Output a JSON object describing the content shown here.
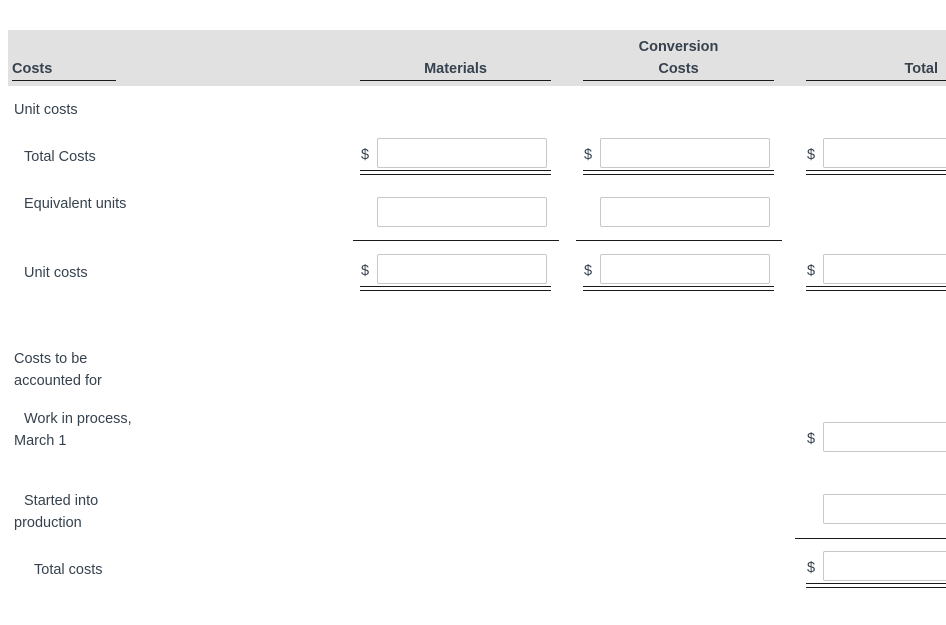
{
  "header": {
    "costs_label": "Costs",
    "materials_label": "Materials",
    "conversion_line1": "Conversion",
    "conversion_line2": "Costs",
    "total_label": "Total",
    "band_color": "#e1e1e1"
  },
  "section_unit_costs": {
    "title": "Unit costs",
    "rows": [
      {
        "label": "Total Costs",
        "materials": {
          "currency": "$",
          "value": "",
          "placeholder": ""
        },
        "conversion": {
          "currency": "$",
          "value": "",
          "placeholder": ""
        },
        "total": {
          "currency": "$",
          "value": "",
          "placeholder": ""
        },
        "rule": "double"
      },
      {
        "label": "Equivalent units",
        "materials": {
          "currency": "",
          "value": "",
          "placeholder": ""
        },
        "conversion": {
          "currency": "",
          "value": "",
          "placeholder": ""
        },
        "total": null,
        "rule": "single"
      },
      {
        "label": "Unit costs",
        "materials": {
          "currency": "$",
          "value": "",
          "placeholder": ""
        },
        "conversion": {
          "currency": "$",
          "value": "",
          "placeholder": ""
        },
        "total": {
          "currency": "$",
          "value": "",
          "placeholder": ""
        },
        "rule": "double"
      }
    ]
  },
  "section_costs_accounted": {
    "title": "Costs to be accounted for",
    "rows": [
      {
        "label": "Work in process, March 1",
        "total": {
          "currency": "$",
          "value": "",
          "placeholder": ""
        },
        "rule": "none"
      },
      {
        "label": "Started into production",
        "total": {
          "currency": "",
          "value": "",
          "placeholder": ""
        },
        "rule": "single"
      },
      {
        "label": "Total costs",
        "total": {
          "currency": "$",
          "value": "",
          "placeholder": ""
        },
        "rule": "double"
      }
    ]
  },
  "colors": {
    "text": "#36424e",
    "rule": "#1a1a1a",
    "input_border": "#c8c8c8",
    "header_band": "#e1e1e1"
  }
}
